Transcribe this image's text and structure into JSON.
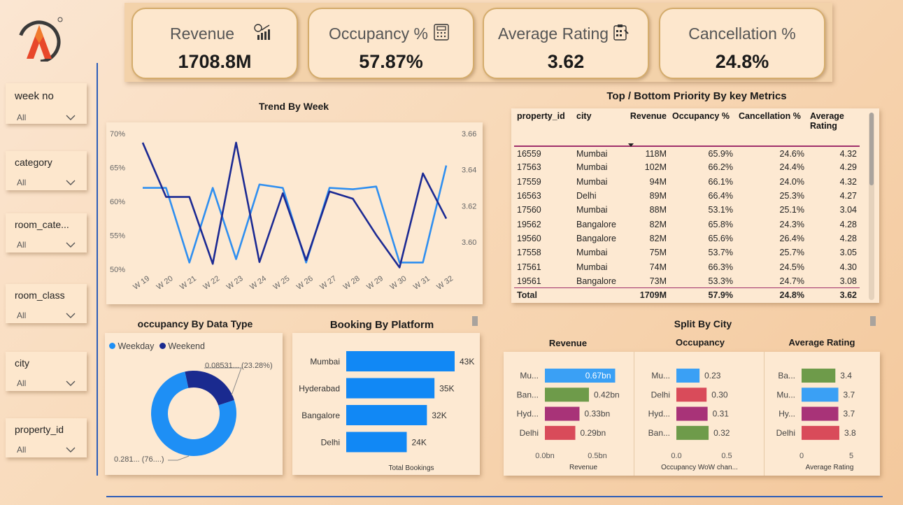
{
  "kpis": [
    {
      "label": "Revenue",
      "value": "1708.8M",
      "icon": "revenue-chart-icon"
    },
    {
      "label": "Occupancy %",
      "value": "57.87%",
      "icon": "calculator-icon"
    },
    {
      "label": "Average Rating",
      "value": "3.62",
      "icon": "rating-clipboard-icon"
    },
    {
      "label": "Cancellation %",
      "value": "24.8%",
      "icon": ""
    }
  ],
  "slicers": [
    {
      "title": "week no",
      "value": "All"
    },
    {
      "title": "category",
      "value": "All"
    },
    {
      "title": "room_cate...",
      "value": "All"
    },
    {
      "title": "room_class",
      "value": "All"
    },
    {
      "title": "city",
      "value": "All"
    },
    {
      "title": "property_id",
      "value": "All"
    }
  ],
  "trend": {
    "title": "Trend By Week",
    "chart_data": {
      "type": "line",
      "categories": [
        "W 19",
        "W 20",
        "W 21",
        "W 22",
        "W 23",
        "W 24",
        "W 25",
        "W 26",
        "W 27",
        "W 28",
        "W 29",
        "W 30",
        "W 31",
        "W 32"
      ],
      "left_axis_ticks": [
        "70%",
        "65%",
        "60%",
        "55%",
        "50%"
      ],
      "right_axis_ticks": [
        "3.66",
        "3.64",
        "3.62",
        "3.60"
      ],
      "left_ylim": [
        50,
        70
      ],
      "right_ylim": [
        3.585,
        3.66
      ],
      "series": [
        {
          "axis": "left",
          "color": "#2f8ff0",
          "values": [
            62,
            62,
            51,
            62,
            51.5,
            62.5,
            62,
            51,
            62,
            61.8,
            62.2,
            51,
            51,
            65.3
          ]
        },
        {
          "axis": "right",
          "color": "#1c2a93",
          "values": [
            3.655,
            3.625,
            3.625,
            3.588,
            3.655,
            3.589,
            3.627,
            3.59,
            3.628,
            3.624,
            3.604,
            3.586,
            3.638,
            3.613
          ]
        }
      ]
    }
  },
  "table": {
    "title": "Top / Bottom Priority By key Metrics",
    "columns": [
      "property_id",
      "city",
      "Revenue",
      "Occupancy %",
      "Cancellation %",
      "Average Rating"
    ],
    "rows": [
      [
        "16559",
        "Mumbai",
        "118M",
        "65.9%",
        "24.6%",
        "4.32"
      ],
      [
        "17563",
        "Mumbai",
        "102M",
        "66.2%",
        "24.4%",
        "4.29"
      ],
      [
        "17559",
        "Mumbai",
        "94M",
        "66.1%",
        "24.0%",
        "4.32"
      ],
      [
        "16563",
        "Delhi",
        "89M",
        "66.4%",
        "25.3%",
        "4.27"
      ],
      [
        "17560",
        "Mumbai",
        "88M",
        "53.1%",
        "25.1%",
        "3.04"
      ],
      [
        "19562",
        "Bangalore",
        "82M",
        "65.8%",
        "24.3%",
        "4.28"
      ],
      [
        "19560",
        "Bangalore",
        "82M",
        "65.6%",
        "26.4%",
        "4.28"
      ],
      [
        "17558",
        "Mumbai",
        "75M",
        "53.7%",
        "25.7%",
        "3.05"
      ],
      [
        "17561",
        "Mumbai",
        "74M",
        "66.3%",
        "24.5%",
        "4.30"
      ],
      [
        "19561",
        "Bangalore",
        "73M",
        "53.3%",
        "24.7%",
        "3.08"
      ]
    ],
    "total": [
      "Total",
      "",
      "1709M",
      "57.9%",
      "24.8%",
      "3.62"
    ]
  },
  "donut": {
    "title": "occupancy By Data Type",
    "legend": [
      {
        "name": "Weekday",
        "color": "#1e8ff5"
      },
      {
        "name": "Weekend",
        "color": "#1a2a8f"
      }
    ],
    "label_weekend": "0.08531... (23.28%)",
    "label_weekday": "0.281... (76....)",
    "chart_data": {
      "type": "pie",
      "categories": [
        "Weekday",
        "Weekend"
      ],
      "values": [
        76.72,
        23.28
      ]
    }
  },
  "platform": {
    "title": "Booking By Platform",
    "xlabel": "Total Bookings",
    "chart_data": {
      "type": "bar",
      "categories": [
        "Mumbai",
        "Hyderabad",
        "Bangalore",
        "Delhi"
      ],
      "values": [
        43,
        35,
        32,
        24
      ],
      "labels": [
        "43K",
        "35K",
        "32K",
        "24K"
      ]
    }
  },
  "split": {
    "title": "Split By City",
    "panels": [
      {
        "title": "Revenue",
        "xlabel": "Revenue",
        "ticks": [
          "0.0bn",
          "0.5bn"
        ],
        "chart_data": {
          "type": "bar",
          "categories": [
            "Mu...",
            "Ban...",
            "Hyd...",
            "Delhi"
          ],
          "values": [
            0.67,
            0.42,
            0.33,
            0.29
          ],
          "labels": [
            "0.67bn",
            "0.42bn",
            "0.33bn",
            "0.29bn"
          ],
          "xlim": [
            0,
            0.5
          ],
          "colors": [
            "#3aa0f5",
            "#6e9b4a",
            "#a83378",
            "#d94b5a"
          ]
        }
      },
      {
        "title": "Occupancy",
        "xlabel": "Occupancy WoW chan...",
        "ticks": [
          "0.0",
          "0.5"
        ],
        "chart_data": {
          "type": "bar",
          "categories": [
            "Mu...",
            "Delhi",
            "Hyd...",
            "Ban..."
          ],
          "values": [
            0.23,
            0.3,
            0.31,
            0.32
          ],
          "labels": [
            "0.23",
            "0.30",
            "0.31",
            "0.32"
          ],
          "xlim": [
            0,
            0.5
          ],
          "colors": [
            "#3aa0f5",
            "#d94b5a",
            "#a83378",
            "#6e9b4a"
          ]
        }
      },
      {
        "title": "Average Rating",
        "xlabel": "Average Rating",
        "ticks": [
          "0",
          "5"
        ],
        "chart_data": {
          "type": "bar",
          "categories": [
            "Ba...",
            "Mu...",
            "Hy...",
            "Delhi"
          ],
          "values": [
            3.4,
            3.7,
            3.7,
            3.8
          ],
          "labels": [
            "3.4",
            "3.7",
            "3.7",
            "3.8"
          ],
          "xlim": [
            0,
            5
          ],
          "colors": [
            "#6e9b4a",
            "#3aa0f5",
            "#a83378",
            "#d94b5a"
          ]
        }
      }
    ]
  }
}
